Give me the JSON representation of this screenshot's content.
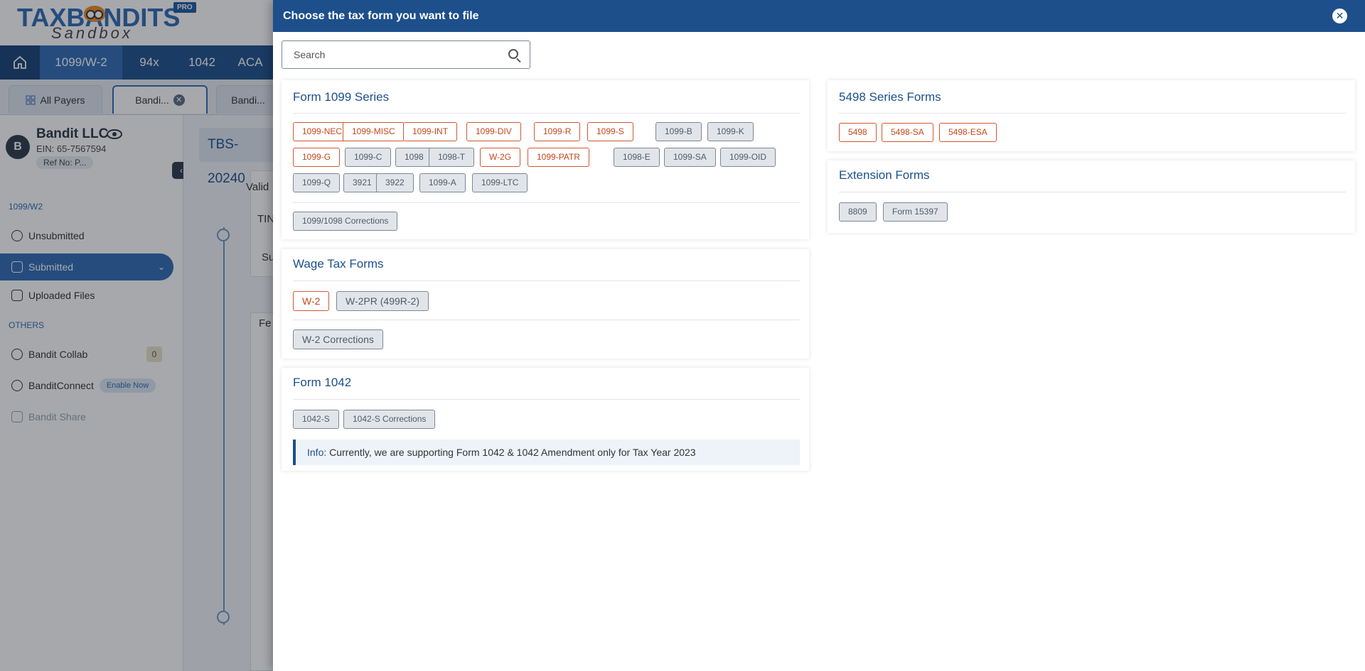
{
  "app": {
    "logo_top": "TAXBANDITS",
    "logo_bottom": "Sandbox",
    "logo_reg": "®",
    "pro_badge": "PRO",
    "nav": [
      "1099/W-2",
      "94x",
      "1042",
      "ACA"
    ],
    "tabs": {
      "all_payers": "All Payers",
      "tab1": "Bandi...",
      "tab2": "Bandi..."
    },
    "payer": {
      "avatar": "B",
      "name": "Bandit LLC",
      "ein": "EIN: 65-7567594",
      "ref": "Ref No: P..."
    },
    "sidebar": {
      "section_1099": "1099/W2",
      "unsubmitted": "Unsubmitted",
      "submitted": "Submitted",
      "uploaded": "Uploaded Files",
      "section_others": "OTHERS",
      "collab": "Bandit Collab",
      "collab_count": "0",
      "connect": "BanditConnect",
      "enable_now": "Enable Now",
      "share": "Bandit Share"
    },
    "main": {
      "tbs": "TBS-20240",
      "valid": "Valid",
      "tin": "TIN",
      "su": "Su",
      "fe": "Fe"
    }
  },
  "dialog": {
    "title": "Choose the tax form you want to file",
    "search_placeholder": "Search",
    "series1099": {
      "title": "Form 1099 Series",
      "row1": [
        {
          "label": "1099-NEC",
          "available": true
        },
        {
          "label": "1099-MISC",
          "available": true
        },
        {
          "label": "1099-INT",
          "available": true
        },
        {
          "label": "1099-DIV",
          "available": true
        },
        {
          "label": "1099-R",
          "available": true
        },
        {
          "label": "1099-S",
          "available": true
        },
        {
          "label": "1099-B",
          "available": false
        },
        {
          "label": "1099-K",
          "available": false
        }
      ],
      "row2": [
        {
          "label": "1099-G",
          "available": true
        },
        {
          "label": "1099-C",
          "available": false
        },
        {
          "label": "1098",
          "available": false
        },
        {
          "label": "1098-T",
          "available": false
        },
        {
          "label": "W-2G",
          "available": true
        },
        {
          "label": "1099-PATR",
          "available": true
        },
        {
          "label": "1098-E",
          "available": false
        },
        {
          "label": "1099-SA",
          "available": false
        },
        {
          "label": "1099-OID",
          "available": false
        }
      ],
      "row3": [
        {
          "label": "1099-Q",
          "available": false
        },
        {
          "label": "3921",
          "available": false
        },
        {
          "label": "3922",
          "available": false
        },
        {
          "label": "1099-A",
          "available": false
        },
        {
          "label": "1099-LTC",
          "available": false
        }
      ],
      "corrections": "1099/1098 Corrections"
    },
    "wage": {
      "title": "Wage Tax Forms",
      "w2": "W-2",
      "w2pr": "W-2PR (499R-2)",
      "corrections": "W-2 Corrections"
    },
    "form1042": {
      "title": "Form 1042",
      "s": "1042-S",
      "corrections": "1042-S Corrections",
      "info_label": "Info:",
      "info_text": " Currently, we are supporting Form 1042 & 1042 Amendment only for Tax Year 2023"
    },
    "series5498": {
      "title": "5498 Series Forms",
      "forms": [
        "5498",
        "5498-SA",
        "5498-ESA"
      ]
    },
    "extension": {
      "title": "Extension Forms",
      "forms": [
        "8809",
        "Form 15397"
      ]
    }
  },
  "colors": {
    "header": "#1d4f8b",
    "available_border": "#d2572e",
    "available_text": "#c4471c",
    "unavailable_bg": "#e1e5ea"
  }
}
